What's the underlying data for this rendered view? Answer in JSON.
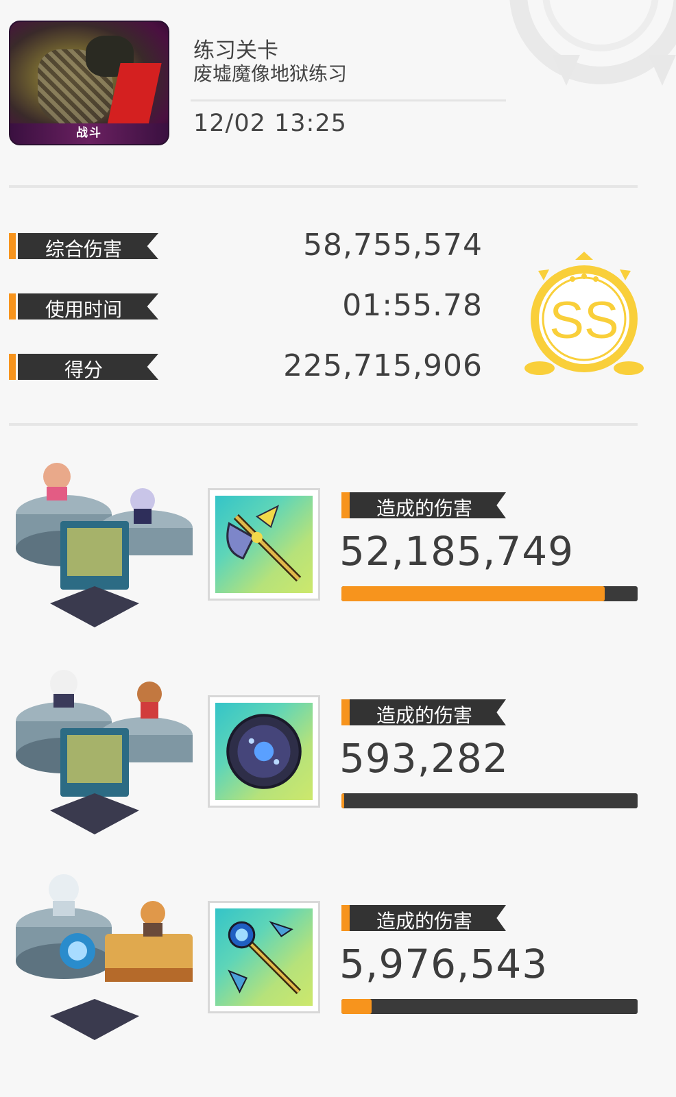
{
  "header": {
    "thumbnail_label": "战斗",
    "title": "练习关卡",
    "subtitle": "废墟魔像地狱练习",
    "datetime": "12/02 13:25"
  },
  "stats": [
    {
      "label": "综合伤害",
      "value": "58,755,574"
    },
    {
      "label": "使用时间",
      "value": "01:55.78"
    },
    {
      "label": "得分",
      "value": "225,715,906"
    }
  ],
  "grade": {
    "rank": "SS",
    "color": "#f9cf3a"
  },
  "accent_color": "#f7941d",
  "party": [
    {
      "damage_label": "造成的伤害",
      "damage": "52,185,749",
      "share": 0.888,
      "weapon_icon": "axe-icon"
    },
    {
      "damage_label": "造成的伤害",
      "damage": "593,282",
      "share": 0.01,
      "weapon_icon": "shield-orb-icon"
    },
    {
      "damage_label": "造成的伤害",
      "damage": "5,976,543",
      "share": 0.102,
      "weapon_icon": "staff-icon"
    }
  ]
}
